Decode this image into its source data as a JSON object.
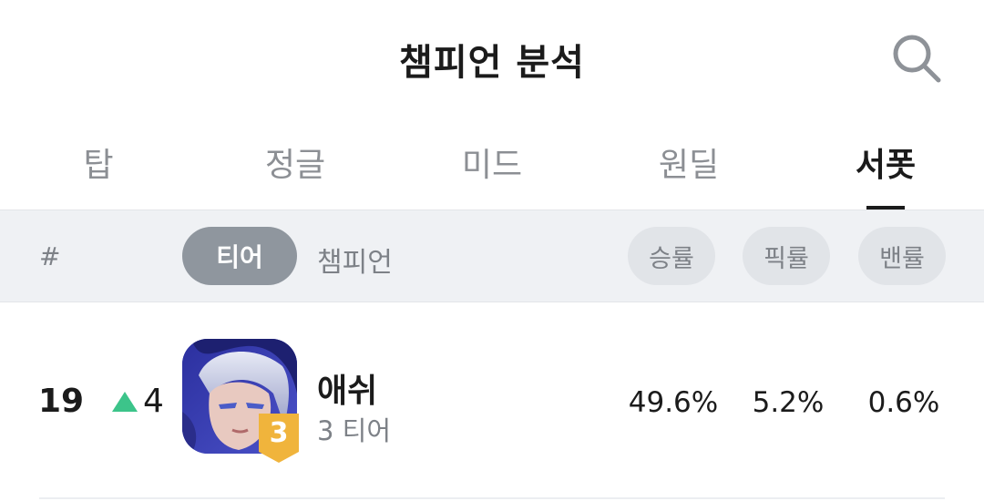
{
  "header": {
    "title": "챔피언 분석",
    "search_icon": "search-icon"
  },
  "tabs": [
    {
      "label": "탑",
      "active": false
    },
    {
      "label": "정글",
      "active": false
    },
    {
      "label": "미드",
      "active": false
    },
    {
      "label": "원딜",
      "active": false
    },
    {
      "label": "서폿",
      "active": true
    }
  ],
  "filter_bar": {
    "hash_label": "#",
    "tier_label": "티어",
    "champion_label": "챔피언",
    "win_rate_label": "승률",
    "pick_rate_label": "픽률",
    "ban_rate_label": "밴률"
  },
  "rows": [
    {
      "rank": "19",
      "trend_direction": "up",
      "trend_value": "4",
      "champion_name": "애쉬",
      "tier_badge": "3",
      "tier_text": "3 티어",
      "win_rate": "49.6%",
      "pick_rate": "5.2%",
      "ban_rate": "0.6%"
    }
  ],
  "colors": {
    "trend_up": "#3cc48a",
    "tier_badge": "#f0b43c",
    "active_pill": "#8f969e",
    "filter_bg": "#eff1f4"
  }
}
